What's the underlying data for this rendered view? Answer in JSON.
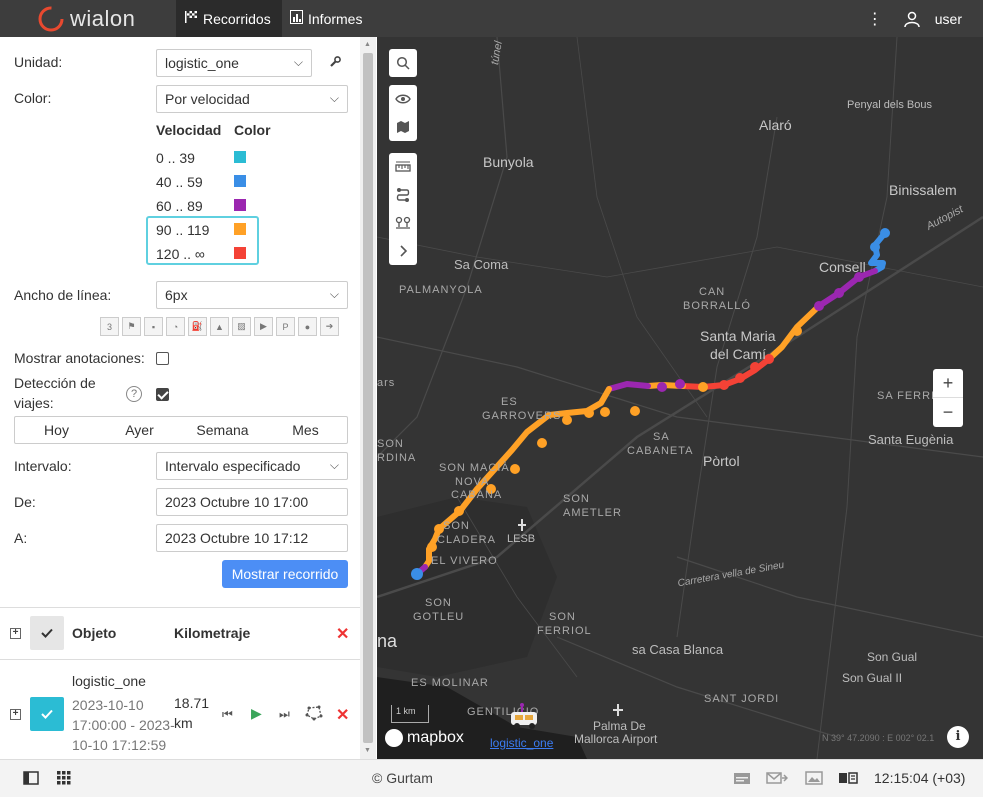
{
  "header": {
    "logo_text": "wialon",
    "tabs": [
      {
        "label": "Recorridos",
        "icon": "flag-checkered-icon"
      },
      {
        "label": "Informes",
        "icon": "report-icon"
      }
    ],
    "user": "user"
  },
  "form": {
    "unit_label": "Unidad:",
    "unit_value": "logistic_one",
    "color_label": "Color:",
    "color_value": "Por velocidad",
    "legend": {
      "speed_header": "Velocidad",
      "color_header": "Color",
      "rows": [
        {
          "range": "0 .. 39",
          "color": "#2bbcd4"
        },
        {
          "range": "40 .. 59",
          "color": "#3a8ee6"
        },
        {
          "range": "60 .. 89",
          "color": "#9b27b0"
        },
        {
          "range": "90 .. 119",
          "color": "#ffa126"
        },
        {
          "range": "120 .. ∞",
          "color": "#f44236"
        }
      ]
    },
    "line_width_label": "Ancho de línea:",
    "line_width_value": "6px",
    "annotations_label": "Mostrar anotaciones:",
    "trip_detect_label_1": "Detección de",
    "trip_detect_label_2": "viajes:",
    "help_glyph": "?",
    "periods": [
      "Hoy",
      "Ayer",
      "Semana",
      "Mes"
    ],
    "interval_label": "Intervalo:",
    "interval_value": "Intervalo especificado",
    "from_label": "De:",
    "from_value": "2023 Octubre 10 17:00",
    "to_label": "A:",
    "to_value": "2023 Octubre 10 17:12",
    "show_button": "Mostrar recorrido"
  },
  "table": {
    "col_object": "Objeto",
    "col_mileage": "Kilometraje",
    "row": {
      "name": "logistic_one",
      "time_line1": "2023-10-10",
      "time_line2": "17:00:00 - 2023-",
      "time_line3": "10-10 17:12:59",
      "km_line1": "18.71",
      "km_line2": "km"
    }
  },
  "map": {
    "labels": {
      "alaro": "Alaró",
      "penyal": "Penyal dels Bous",
      "bunyola": "Bunyola",
      "binissalem": "Binissalem",
      "sacoma": "Sa Coma",
      "consell": "Consell",
      "palmanyola": "PALMANYOLA",
      "can": "CAN",
      "borrallo": "BORRALLÓ",
      "santamaria1": "Santa Maria",
      "santamaria2": "del Camí",
      "es_garrovers": "ES",
      "garrovers": "GARROVERS",
      "sa": "SA",
      "cabaneta": "CABANETA",
      "portol": "Pòrtol",
      "santa_eugenia": "Santa Eugènia",
      "son_macia": "SON MACIÀ",
      "nova": "NOVA",
      "cabana": "CABANA",
      "son_sardina1": "SON",
      "son_sardina2": "RDINA",
      "son_ameter1": "SON",
      "son_ameter2": "AMETLER",
      "lesb": "LESB",
      "son_cladera1": "SON",
      "son_cladera2": "CLADERA",
      "el_vivero": "EL VIVERO",
      "son_gotleu1": "SON",
      "son_gotleu2": "GOTLEU",
      "son_ferriol1": "SON",
      "son_ferriol2": "FERRIOL",
      "casa_blanca": "sa Casa Blanca",
      "son_gual": "Son Gual",
      "son_gual2": "Son Gual II",
      "es_molinar": "ES MOLINAR",
      "sant_jordi": "SANT JORDI",
      "gentilicio": "GENTILICIO",
      "airport1": "Palma De",
      "airport2": "Mallorca Airport",
      "carretera": "Carretera vella de Sineu",
      "sa_ferre": "SA FERRE",
      "autopista": "Autopist",
      "tunel": "túnel",
      "palma_na": "na",
      "ars": "ars"
    },
    "unit_label": "logistic_one",
    "mapbox": "mapbox",
    "scale": "1 km",
    "coords": "N 39° 47.2090 : E 002° 02.1",
    "zoom_in": "+",
    "zoom_out": "−",
    "info": "i"
  },
  "footer": {
    "copyright": "© Gurtam",
    "clock": "12:15:04 (+03)"
  }
}
